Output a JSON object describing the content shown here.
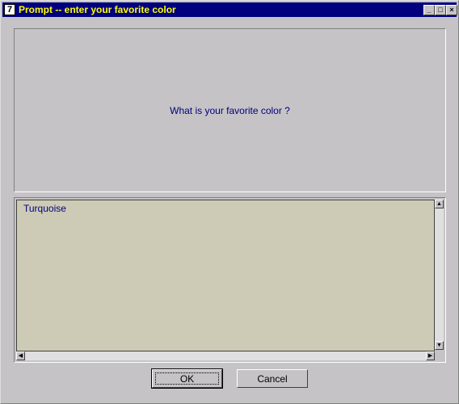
{
  "window": {
    "title": "Prompt -- enter your favorite color",
    "app_icon": "7",
    "controls": {
      "minimize": "_",
      "maximize": "□",
      "close": "×"
    }
  },
  "prompt": {
    "question": "What is your favorite color ?"
  },
  "input": {
    "value": "Turquoise"
  },
  "scrollbars": {
    "up": "▲",
    "down": "▼",
    "left": "◀",
    "right": "▶"
  },
  "buttons": {
    "ok": "OK",
    "cancel": "Cancel"
  }
}
